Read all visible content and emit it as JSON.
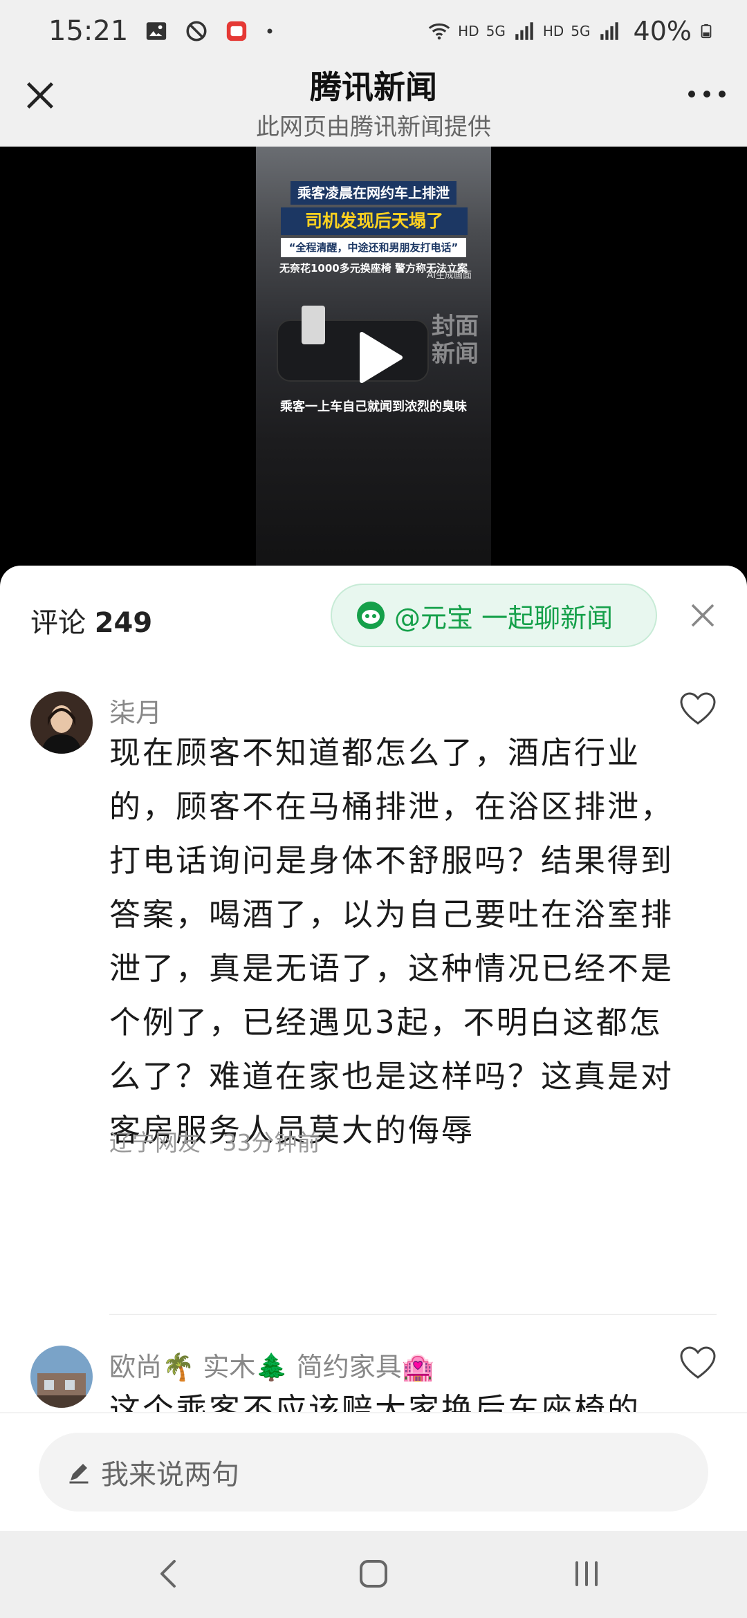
{
  "status_bar": {
    "time": "15:21",
    "network_1": "HD",
    "network_1_gen": "5G",
    "network_2": "HD",
    "network_2_gen": "5G",
    "battery": "40%"
  },
  "title_bar": {
    "title": "腾讯新闻",
    "subtitle": "此网页由腾讯新闻提供"
  },
  "video": {
    "headline_1": "乘客凌晨在网约车上排泄",
    "headline_2": "司机发现后天塌了",
    "headline_3": "“全程清醒，中途还和男朋友打电话”",
    "headline_4": "无奈花1000多元换座椅 警方称无法立案",
    "ai_tag": "AI生成画面",
    "watermark": "封面\n新闻",
    "subtitle": "乘客一上车自己就闻到浓烈的臭味",
    "play_icon": "play-icon"
  },
  "comments_header": {
    "label": "评论",
    "count": "249",
    "yuanbao_label": "@元宝 一起聊新闻"
  },
  "comments": [
    {
      "user": "柒月",
      "body": "现在顾客不知道都怎么了，酒店行业的，顾客不在马桶排泄，在浴区排泄，打电话询问是身体不舒服吗？结果得到答案，喝酒了，以为自己要吐在浴室排泄了，真是无语了，这种情况已经不是个例了，已经遇见3起，不明白这都怎么了？难道在家也是这样吗？这真是对客房服务人员莫大的侮辱",
      "meta": "辽宁网友 · 33分钟前"
    },
    {
      "user": "欧尚🌴 实木🌲 简约家具🏩",
      "body": "这个乘客不应该赔大家换后车座椅的"
    }
  ],
  "input": {
    "placeholder": "我来说两句"
  },
  "colors": {
    "accent_green": "#15a04a",
    "pill_bg": "#e8f7ef"
  }
}
